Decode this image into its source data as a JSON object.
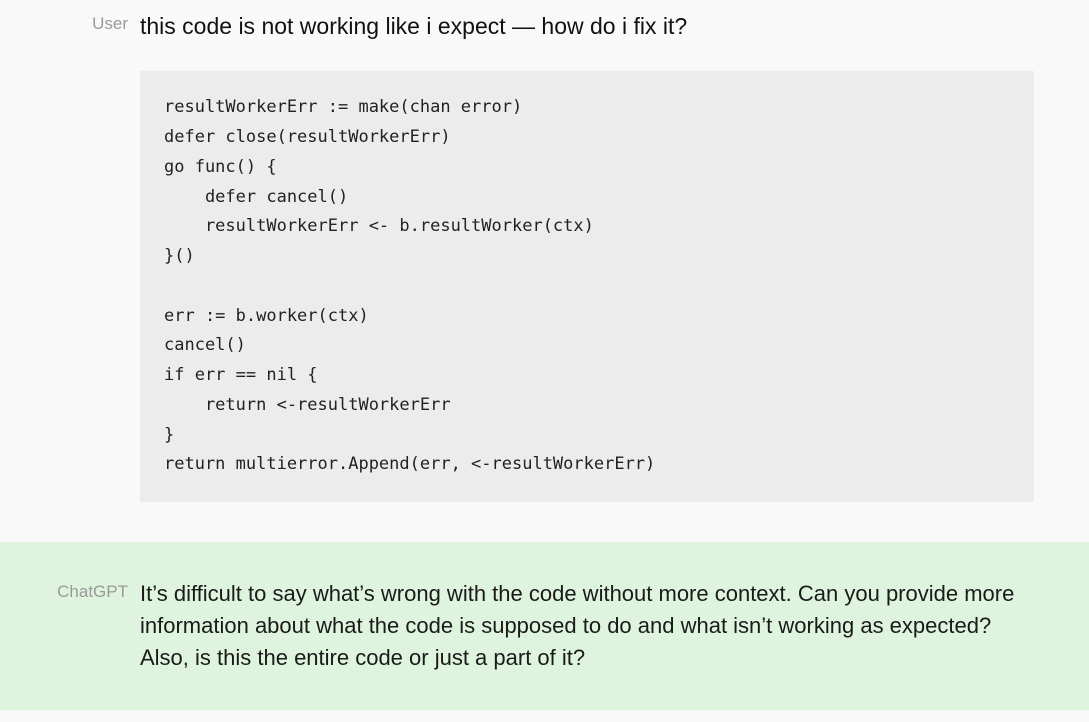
{
  "user": {
    "role_label": "User",
    "question": "this code is not working like i expect — how do i fix it?",
    "code": "resultWorkerErr := make(chan error)\ndefer close(resultWorkerErr)\ngo func() {\n    defer cancel()\n    resultWorkerErr <- b.resultWorker(ctx)\n}()\n\nerr := b.worker(ctx)\ncancel()\nif err == nil {\n    return <-resultWorkerErr\n}\nreturn multierror.Append(err, <-resultWorkerErr)"
  },
  "assistant": {
    "role_label": "ChatGPT",
    "reply": "It’s difficult to say what’s wrong with the code without more context. Can you provide more information about what the code is supposed to do and what isn’t working as expected? Also, is this the entire code or just a part of it?"
  }
}
